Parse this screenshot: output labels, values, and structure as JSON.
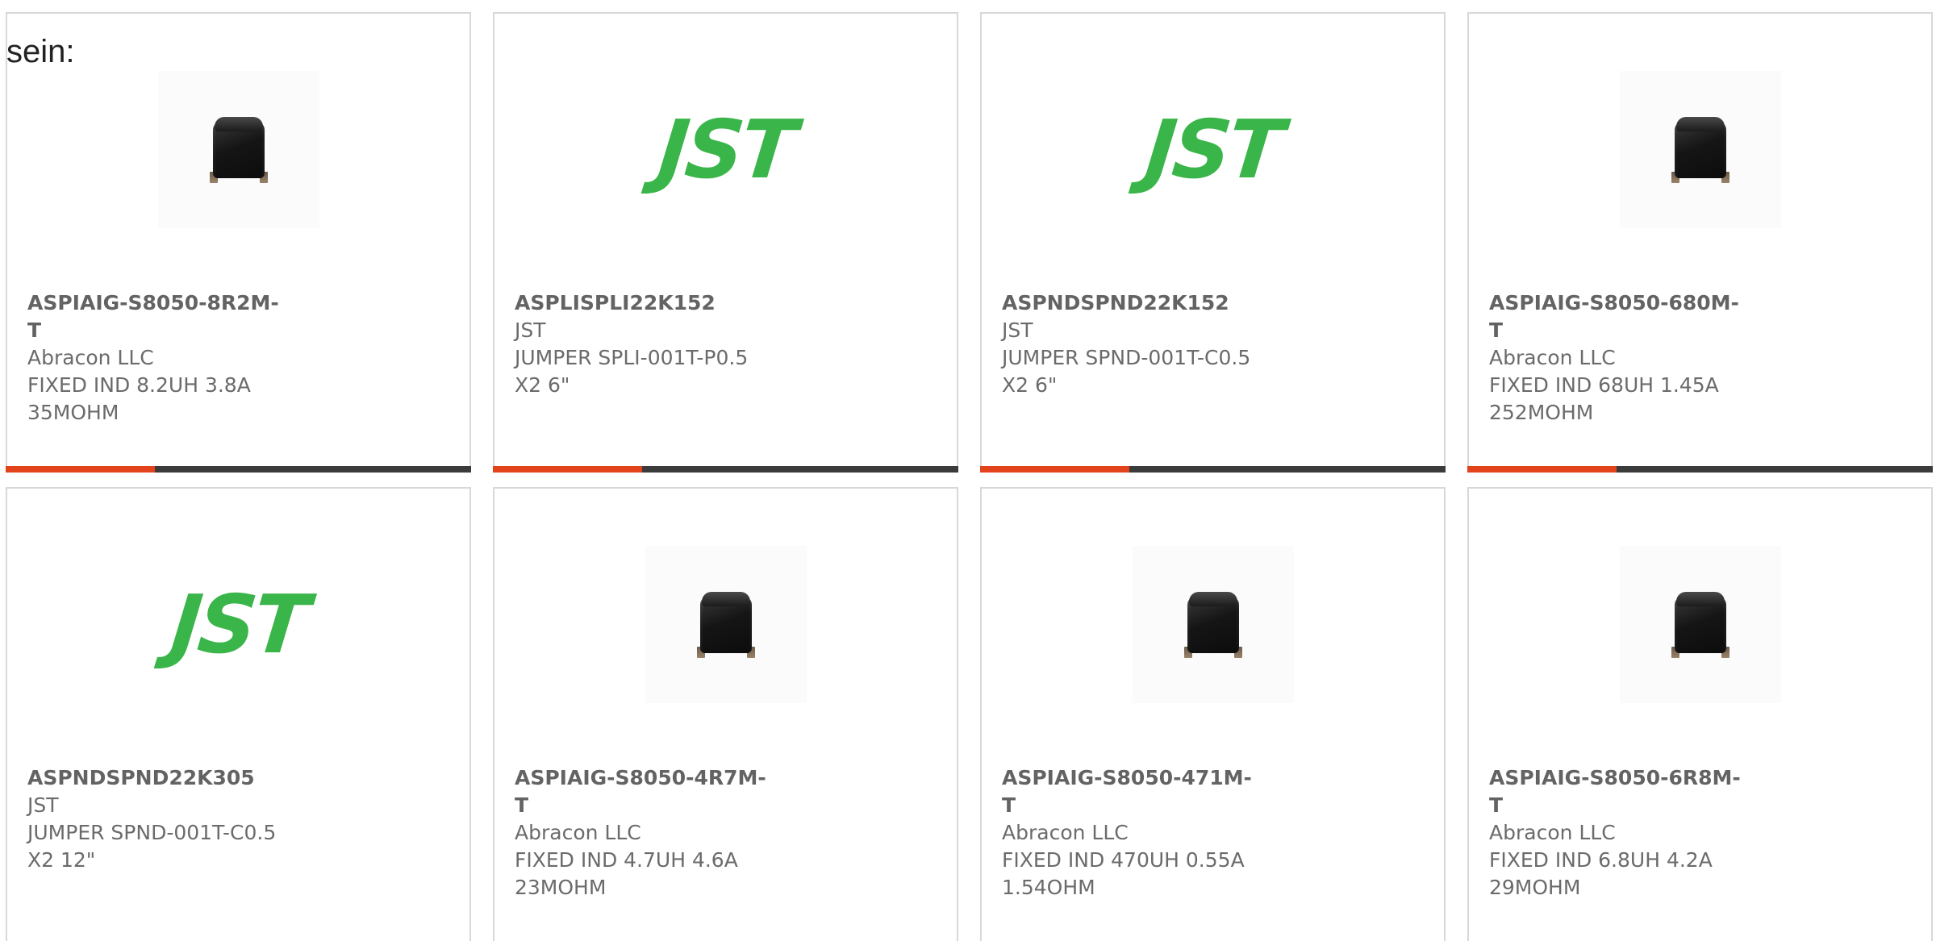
{
  "intro_text": "sein:",
  "colors": {
    "progress_fill": "#e2431b",
    "progress_track": "#3b3b3b",
    "jst_green": "#3ab54a",
    "card_border": "#d8d8d8"
  },
  "cards": [
    {
      "part_number": "ASPIAIG-S8050-8R2M-T",
      "manufacturer": "Abracon LLC",
      "description": "FIXED IND 8.2UH 3.8A 35MOHM",
      "image": "inductor-photo",
      "progress": 0.32
    },
    {
      "part_number": "ASPLISPLI22K152",
      "manufacturer": "JST",
      "description": "JUMPER SPLI-001T-P0.5 X2 6\"",
      "image": "jst-logo",
      "logo_text": "JST",
      "progress": 0.32
    },
    {
      "part_number": "ASPNDSPND22K152",
      "manufacturer": "JST",
      "description": "JUMPER SPND-001T-C0.5 X2 6\"",
      "image": "jst-logo",
      "logo_text": "JST",
      "progress": 0.32
    },
    {
      "part_number": "ASPIAIG-S8050-680M-T",
      "manufacturer": "Abracon LLC",
      "description": "FIXED IND 68UH 1.45A 252MOHM",
      "image": "inductor-photo",
      "progress": 0.32
    },
    {
      "part_number": "ASPNDSPND22K305",
      "manufacturer": "JST",
      "description": "JUMPER SPND-001T-C0.5 X2 12\"",
      "image": "jst-logo",
      "logo_text": "JST"
    },
    {
      "part_number": "ASPIAIG-S8050-4R7M-T",
      "manufacturer": "Abracon LLC",
      "description": "FIXED IND 4.7UH 4.6A 23MOHM",
      "image": "inductor-photo"
    },
    {
      "part_number": "ASPIAIG-S8050-471M-T",
      "manufacturer": "Abracon LLC",
      "description": "FIXED IND 470UH 0.55A 1.54OHM",
      "image": "inductor-photo"
    },
    {
      "part_number": "ASPIAIG-S8050-6R8M-T",
      "manufacturer": "Abracon LLC",
      "description": "FIXED IND 6.8UH 4.2A 29MOHM",
      "image": "inductor-photo"
    }
  ]
}
